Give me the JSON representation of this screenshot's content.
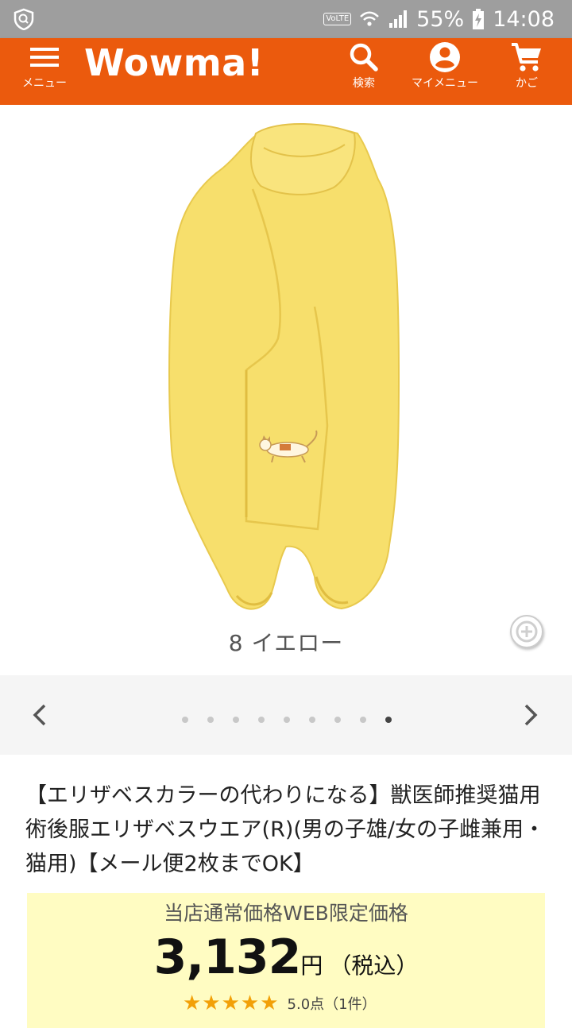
{
  "status_bar": {
    "network": "VoLTE",
    "battery": "55%",
    "time": "14:08"
  },
  "header": {
    "logo": "Wowma!",
    "menu_label": "メニュー",
    "search_label": "検索",
    "mymenu_label": "マイメニュー",
    "cart_label": "かご",
    "brand_color": "#eb5a0d"
  },
  "product_image": {
    "caption": "8 イエロー",
    "icons": {
      "zoom": "zoom-in-icon",
      "prev": "chevron-left-icon",
      "next": "chevron-right-icon"
    }
  },
  "carousel": {
    "total_slides": 9,
    "active_index": 8
  },
  "product": {
    "title": "【エリザベスカラーの代わりになる】獣医師推奨猫用術後服エリザベスウエア(R)(男の子雄/女の子雌兼用・猫用)【メール便2枚までOK】",
    "price_label": "当店通常価格WEB限定価格",
    "price": "3,132",
    "currency": "円",
    "tax_note": "（税込）",
    "stars": "★★★★★",
    "rating": 5.0,
    "rating_text": "5.0点（1件）"
  }
}
